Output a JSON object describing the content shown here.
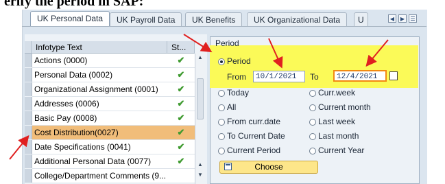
{
  "heading": "erify the period in SAP:",
  "tabs": [
    {
      "label": "UK Personal Data",
      "active": true
    },
    {
      "label": "UK Payroll Data"
    },
    {
      "label": "UK Benefits"
    },
    {
      "label": "UK Organizational Data"
    },
    {
      "label": "U"
    }
  ],
  "table": {
    "columns": [
      "Infotype Text",
      "St..."
    ],
    "rows": [
      {
        "text": "Actions (0000)",
        "status": "✔"
      },
      {
        "text": "Personal Data (0002)",
        "status": "✔"
      },
      {
        "text": "Organizational Assignment (0001)",
        "status": "✔"
      },
      {
        "text": "Addresses (0006)",
        "status": "✔"
      },
      {
        "text": "Basic Pay (0008)",
        "status": "✔"
      },
      {
        "text": "Cost Distribution(0027)",
        "status": "✔",
        "selected": true
      },
      {
        "text": "Date Specifications (0041)",
        "status": "✔"
      },
      {
        "text": "Additional Personal Data (0077)",
        "status": "✔"
      },
      {
        "text": "College/Department Comments (9...",
        "status": ""
      }
    ]
  },
  "period": {
    "title": "Period",
    "selected_option": "Period",
    "option_period": "Period",
    "from_label": "From",
    "from_value": "10/1/2021",
    "to_label": "To",
    "to_value": "12/4/2021",
    "options_left": [
      "Today",
      "All",
      "From curr.date",
      "To Current Date",
      "Current Period"
    ],
    "options_right": [
      "Curr.week",
      "Current month",
      "Last week",
      "Last month",
      "Current Year"
    ],
    "choose_label": "Choose"
  },
  "colors": {
    "highlight_yellow": "#fbfa58",
    "selected_row": "#f1bd7a",
    "annotation_arrow": "#e02020",
    "check_green": "#3e9a2f"
  }
}
